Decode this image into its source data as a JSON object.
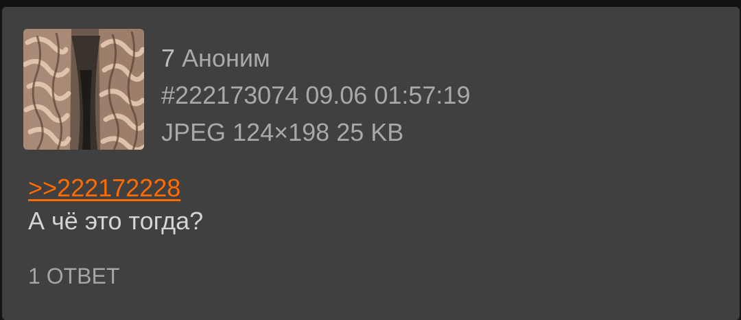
{
  "post": {
    "number": "7",
    "author": "Аноним",
    "post_id": "#222173074",
    "date": "09.06",
    "time": "01:57:19",
    "file_type": "JPEG",
    "dimensions": "124×198",
    "file_size": "25 KB",
    "reply_link": ">>222172228",
    "comment": "А чё это тогда?",
    "replies_label": "1 ОТВЕТ",
    "thumbnail_icon": "image-thumbnail"
  },
  "colors": {
    "background": "#141414",
    "card": "#404040",
    "meta_text": "#a9a9a9",
    "link": "#ff6b00",
    "comment_text": "#d4d4d4"
  }
}
